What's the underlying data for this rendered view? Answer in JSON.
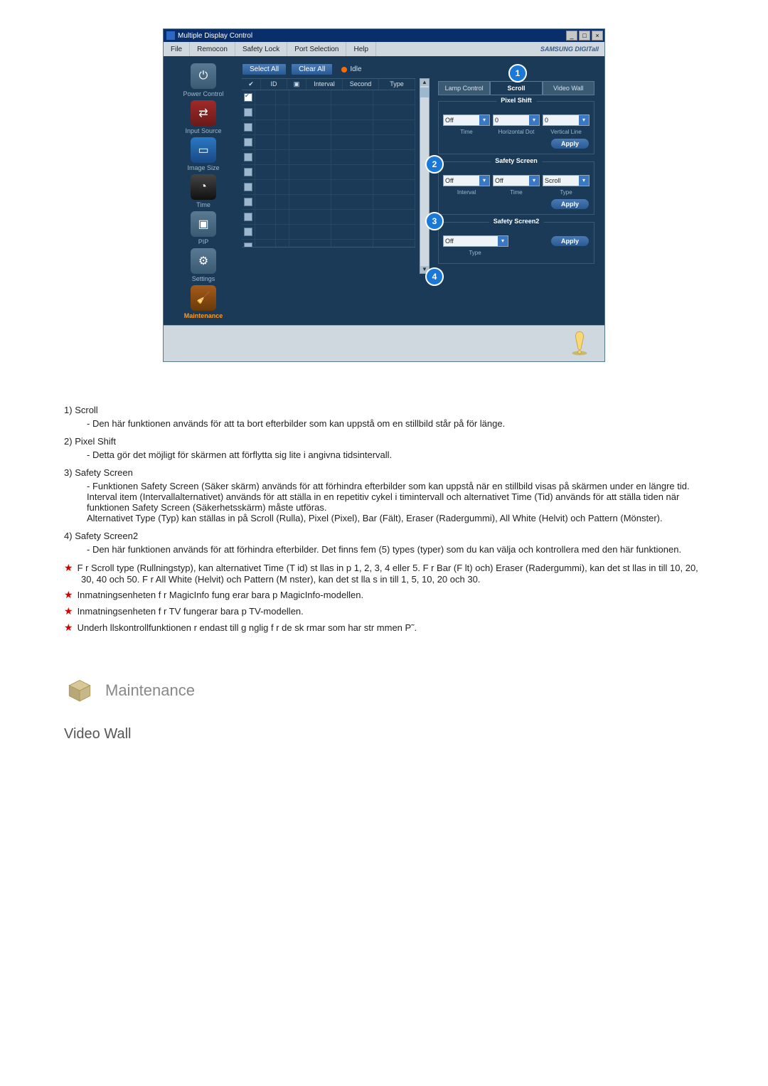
{
  "window": {
    "title": "Multiple Display Control",
    "brand": "SAMSUNG DIGITall"
  },
  "menu": [
    "File",
    "Remocon",
    "Safety Lock",
    "Port Selection",
    "Help"
  ],
  "toolbar": {
    "select_all": "Select All",
    "clear_all": "Clear All",
    "idle": "Idle"
  },
  "sidebar": [
    {
      "label": "Power Control",
      "active": false
    },
    {
      "label": "Input Source",
      "active": false
    },
    {
      "label": "Image Size",
      "active": false
    },
    {
      "label": "Time",
      "active": false
    },
    {
      "label": "PIP",
      "active": false
    },
    {
      "label": "Settings",
      "active": false
    },
    {
      "label": "Maintenance",
      "active": true
    }
  ],
  "columns": [
    "",
    "ID",
    "",
    "Interval",
    "Second",
    "Type"
  ],
  "tabs": [
    "Lamp Control",
    "Scroll",
    "Video Wall"
  ],
  "active_tab": 1,
  "badges": {
    "b1": "1",
    "b2": "2",
    "b3": "3",
    "b4": "4"
  },
  "panel": {
    "pixel_shift": {
      "title": "Pixel Shift",
      "values": [
        "Off",
        "0",
        "0"
      ],
      "labels": [
        "Time",
        "Horizontal Dot",
        "Vertical Line"
      ],
      "apply": "Apply"
    },
    "safety_screen": {
      "title": "Safety Screen",
      "values": [
        "Off",
        "Off",
        "Scroll"
      ],
      "labels": [
        "Interval",
        "Time",
        "Type"
      ],
      "apply": "Apply"
    },
    "safety_screen2": {
      "title": "Safety Screen2",
      "value": "Off",
      "label": "Type",
      "apply": "Apply"
    }
  },
  "doc_items": [
    {
      "num": "1)",
      "title": "Scroll",
      "desc": "- Den här funktionen används för att ta bort efterbilder som kan uppstå om en stillbild står på för länge."
    },
    {
      "num": "2)",
      "title": "Pixel Shift",
      "desc": "- Detta gör det möjligt för skärmen att förflytta sig lite i angivna tidsintervall."
    },
    {
      "num": "3)",
      "title": "Safety Screen",
      "desc": "- Funktionen Safety Screen (Säker skärm) används för att förhindra efterbilder som kan uppstå när en stillbild visas på skärmen under en längre tid.  Interval item (Intervallalternativet) används för att ställa in en repetitiv cykel i timintervall och alternativet Time (Tid) används för att ställa tiden när funktionen Safety Screen (Säkerhetsskärm) måste utföras.\nAlternativet Type (Typ) kan ställas in på Scroll (Rulla), Pixel (Pixel), Bar (Fält), Eraser (Radergummi), All White (Helvit) och Pattern (Mönster)."
    },
    {
      "num": "4)",
      "title": "Safety Screen2",
      "desc": "- Den här funktionen används för att förhindra efterbilder. Det finns fem (5) types (typer) som du kan välja och kontrollera med den här funktionen."
    }
  ],
  "stars": [
    "F r Scroll type (Rullningstyp), kan alternativet Time (T          id) st llas in p  1, 2, 3, 4 eller 5. F r Bar (F lt) och) Eraser (Radergummi), kan det st llas in till           10, 20, 30, 40 och 50. F r All White (Helvit) och Pattern (M nster), kan det st lla          s in till 1, 5, 10, 20 och 30.",
    "Inmatningsenheten f r MagicInfo fung          erar bara p  MagicInfo-modellen.",
    "Inmatningsenheten f r TV fungerar bara p  TV-modellen.",
    "Underh llskontrollfunktionen  r endast till          g nglig f r de sk rmar som har str mmen P˜."
  ],
  "section": {
    "heading": "Maintenance",
    "sub": "Video Wall"
  }
}
